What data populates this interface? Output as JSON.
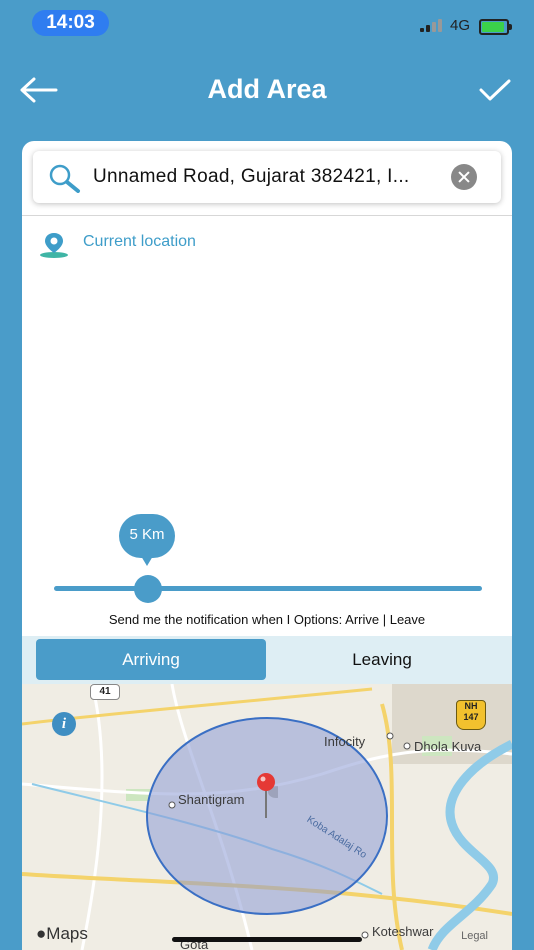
{
  "status_bar": {
    "time": "14:03",
    "network": "4G"
  },
  "header": {
    "title": "Add Area"
  },
  "search": {
    "value": "Unnamed Road, Gujarat 382421, I..."
  },
  "current_location": {
    "label": "Current location"
  },
  "radius": {
    "label": "5 Km",
    "slider_fraction": 0.2
  },
  "notify_text": "Send me the notification when I Options: Arrive | Leave",
  "segments": {
    "arriving": "Arriving",
    "leaving": "Leaving",
    "selected": "arriving"
  },
  "map": {
    "places": {
      "shantigram": "Shantigram",
      "infocity": "Infocity",
      "dhola_kuva": "Dhola Kuva",
      "koteshwar": "Koteshwar",
      "koba_road": "Koba Adalaj Ro",
      "gota": "Gota"
    },
    "highways": {
      "nh41": "41",
      "nh147_prefix": "NH",
      "nh147": "147"
    },
    "attribution": "Maps",
    "legal": "Legal"
  },
  "colors": {
    "accent": "#4a9cc9",
    "pin": "#e53935",
    "geofence": "#3a6fc4"
  }
}
